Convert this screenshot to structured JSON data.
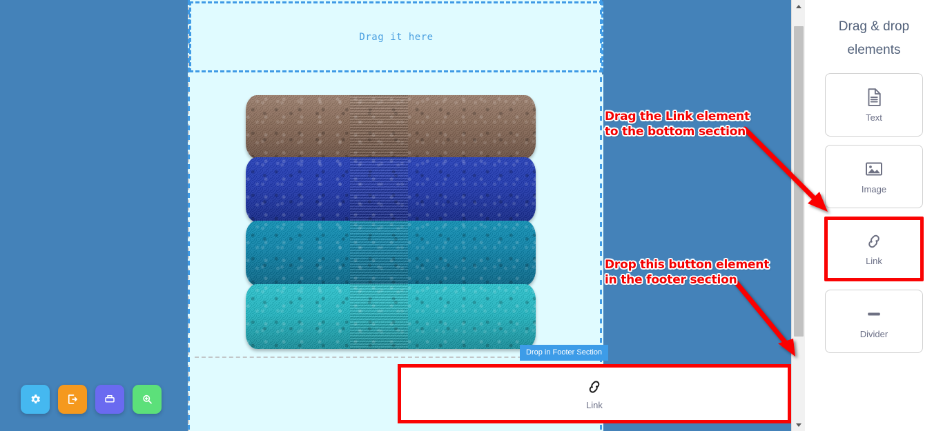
{
  "theme": {
    "workspace_bg": "#4482b9",
    "canvas_bg": "#e0fbff",
    "accent_blue": "#3f9ae5",
    "highlight_red": "#fa0303",
    "panel_bg": "#ffffff"
  },
  "canvas": {
    "header_dropzone": {
      "text": "Drag it here",
      "icon": "dropzone-dashed-icon"
    },
    "body": {
      "image_alt": "Stack of four folded towels",
      "towels": [
        {
          "name": "brown-towel",
          "color": "#876a58"
        },
        {
          "name": "royal-blue-towel",
          "color": "#2139ad"
        },
        {
          "name": "teal-towel",
          "color": "#0f83a8"
        },
        {
          "name": "turquoise-towel",
          "color": "#24b4bf"
        }
      ]
    },
    "footer_badge": {
      "label": "Drop in Footer Section",
      "bg": "#3d9ce8"
    },
    "footer": {
      "divider": "dashed-divider"
    }
  },
  "drag_ghost": {
    "label": "Link",
    "icon": "link-chain-icon",
    "border_color": "#fa0303"
  },
  "annotations": [
    {
      "id": "callout-link",
      "text": "Drag the Link element\nto the bottom section",
      "color": "#f40000",
      "arrow": "red-arrow-down-right"
    },
    {
      "id": "callout-footer",
      "text": "Drop this button element\nin the footer section",
      "color": "#f40000",
      "arrow": "red-arrow-down"
    }
  ],
  "scrollbar": {
    "up_arrow": "scroll-up-arrow-icon",
    "down_arrow": "scroll-down-arrow-icon",
    "thumb": "scroll-thumb"
  },
  "right_panel": {
    "title": "Drag & drop elements",
    "elements": [
      {
        "label": "Text",
        "icon": "document-text-icon",
        "highlighted": false
      },
      {
        "label": "Image",
        "icon": "image-picture-icon",
        "highlighted": false
      },
      {
        "label": "Link",
        "icon": "link-chain-icon",
        "highlighted": true
      },
      {
        "label": "Divider",
        "icon": "divider-bar-icon",
        "highlighted": false
      }
    ]
  },
  "toolbar": {
    "buttons": [
      {
        "name": "settings-button",
        "icon": "gear-icon",
        "color": "#45b8f0"
      },
      {
        "name": "export-button",
        "icon": "export-icon",
        "color": "#f5991e"
      },
      {
        "name": "print-button",
        "icon": "printer-icon",
        "color": "#6a6af0"
      },
      {
        "name": "zoom-button",
        "icon": "zoom-in-icon",
        "color": "#5ce07a"
      }
    ]
  }
}
